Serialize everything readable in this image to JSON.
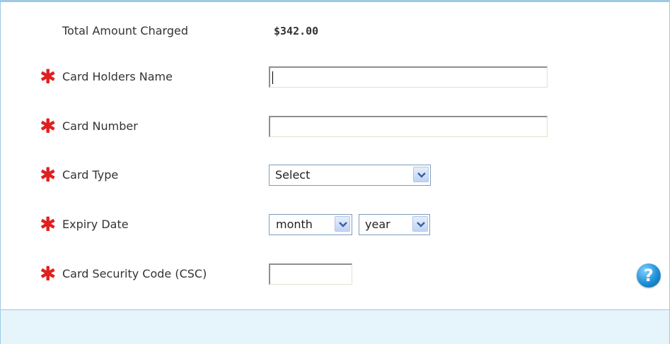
{
  "total": {
    "label": "Total Amount Charged",
    "value": "$342.00"
  },
  "required_marker": "✱",
  "fields": {
    "card_holder_name": {
      "label": "Card Holders Name",
      "value": ""
    },
    "card_number": {
      "label": "Card Number",
      "value": ""
    },
    "card_type": {
      "label": "Card Type",
      "selected": "Select"
    },
    "expiry_date": {
      "label": "Expiry Date",
      "month_selected": "month",
      "year_selected": "year"
    },
    "csc": {
      "label": "Card Security Code (CSC)",
      "value": ""
    }
  },
  "help": {
    "icon": "question-icon",
    "glyph": "?"
  },
  "colors": {
    "border": "#9ccae4",
    "footer_bg": "#e6f4fb",
    "required": "#e02020",
    "help_accent": "#1e8fd6"
  }
}
